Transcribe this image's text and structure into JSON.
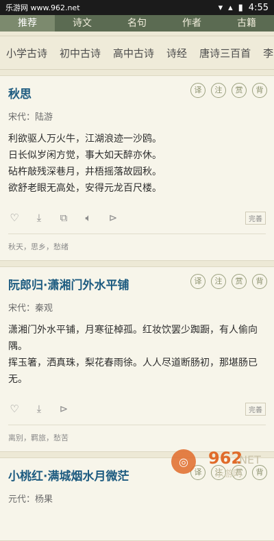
{
  "status": {
    "left": "乐游网 www.962.net",
    "time": "4:55"
  },
  "tabs": [
    {
      "label": "推荐"
    },
    {
      "label": "诗文"
    },
    {
      "label": "名句"
    },
    {
      "label": "作者"
    },
    {
      "label": "古籍"
    }
  ],
  "categories": [
    "小学古诗",
    "初中古诗",
    "高中古诗",
    "诗经",
    "唐诗三百首",
    "李白"
  ],
  "circle_labels": [
    "译",
    "注",
    "赏",
    "背"
  ],
  "poems": [
    {
      "title": "秋思",
      "dynasty": "宋代：陆游",
      "lines": [
        "利欲驱人万火牛，江湖浪迹一沙鸥。",
        "日长似岁闲方觉，事大如天醉亦休。",
        "砧杵敲残深巷月，井梧摇落故园秋。",
        "欲舒老眼无高处，安得元龙百尺楼。"
      ],
      "tags": "秋天，思乡，愁绪",
      "wanshan": "完善"
    },
    {
      "title": "阮郎归·潇湘门外水平铺",
      "dynasty": "宋代：秦观",
      "lines": [
        "潇湘门外水平铺，月寒征棹孤。红妆饮罢少踟蹰，有人偷向隅。",
        "挥玉箸，洒真珠，梨花春雨徐。人人尽道断肠初，那堪肠已无。"
      ],
      "tags": "离别，羁旅，愁苦",
      "wanshan": "完善"
    },
    {
      "title": "小桃红·满城烟水月微茫",
      "dynasty": "元代：杨果",
      "lines": [],
      "tags": "",
      "wanshan": ""
    }
  ],
  "watermark": {
    "text": "962",
    "sub": "乐游网"
  }
}
